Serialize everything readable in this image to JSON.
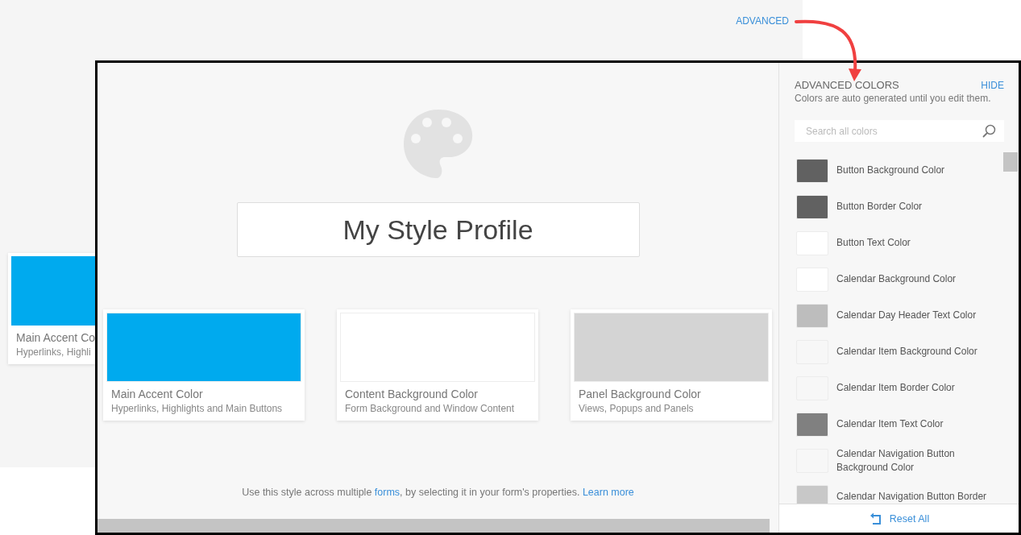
{
  "background_screen": {
    "advanced_link": "ADVANCED",
    "card": {
      "title": "Main Accent Co",
      "subtitle": "Hyperlinks, Highli",
      "color": "#00aaee"
    }
  },
  "style_editor": {
    "profile_name": "My Style Profile",
    "color_cards": [
      {
        "title": "Main Accent Color",
        "subtitle": "Hyperlinks, Highlights and Main Buttons",
        "color": "#00aaee"
      },
      {
        "title": "Content Background Color",
        "subtitle": "Form Background and Window Content",
        "color": "#ffffff"
      },
      {
        "title": "Panel Background Color",
        "subtitle": "Views, Popups and Panels",
        "color": "#d4d4d4"
      }
    ],
    "footer": {
      "text_before": "Use this style across multiple ",
      "forms_link": "forms",
      "text_after": ", by selecting it in your form's properties. ",
      "learn_more_link": "Learn more"
    }
  },
  "advanced_panel": {
    "title": "ADVANCED COLORS",
    "hide": "HIDE",
    "subtitle": "Colors are auto generated until you edit them.",
    "search": {
      "placeholder": "Search all colors"
    },
    "colors": [
      {
        "name": "Button Background Color",
        "color": "#616161"
      },
      {
        "name": "Button Border Color",
        "color": "#616161"
      },
      {
        "name": "Button Text Color",
        "color": "#ffffff"
      },
      {
        "name": "Calendar Background Color",
        "color": "#ffffff"
      },
      {
        "name": "Calendar Day Header Text Color",
        "color": "#bdbdbd"
      },
      {
        "name": "Calendar Item Background Color",
        "color": "#f7f7f7"
      },
      {
        "name": "Calendar Item Border Color",
        "color": "#f7f7f7"
      },
      {
        "name": "Calendar Item Text Color",
        "color": "#808080"
      },
      {
        "name": "Calendar Navigation Button Background Color",
        "color": "#f7f7f7"
      },
      {
        "name": "Calendar Navigation Button Border",
        "color": "#c8c8c8"
      }
    ],
    "reset": "Reset All"
  }
}
